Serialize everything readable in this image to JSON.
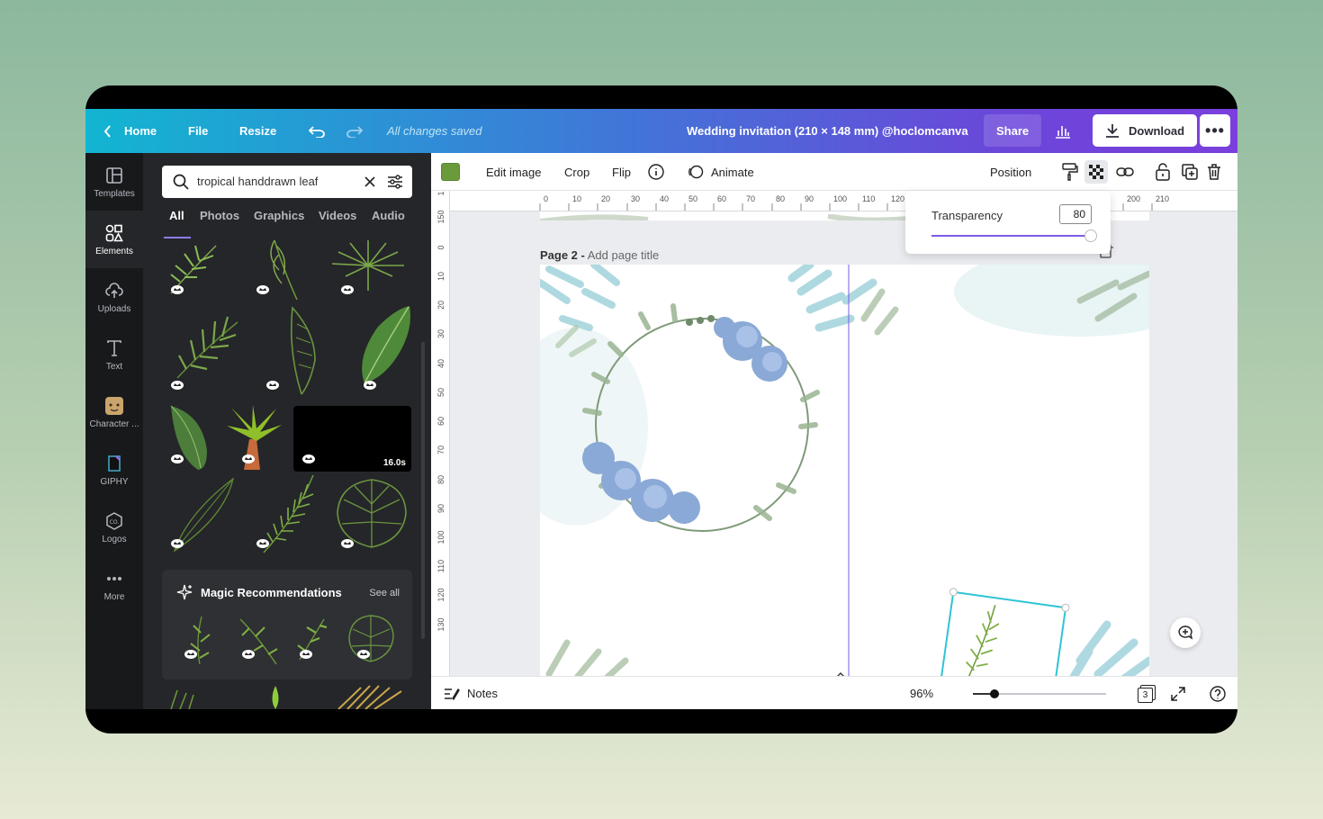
{
  "topbar": {
    "home": "Home",
    "file": "File",
    "resize": "Resize",
    "saved_status": "All changes saved",
    "doc_title": "Wedding invitation  (210 × 148 mm) @hoclomcanva",
    "share": "Share",
    "download": "Download",
    "more": "•••"
  },
  "rail": [
    {
      "label": "Templates",
      "icon": "templates-icon"
    },
    {
      "label": "Elements",
      "icon": "elements-icon"
    },
    {
      "label": "Uploads",
      "icon": "uploads-icon"
    },
    {
      "label": "Text",
      "icon": "text-icon"
    },
    {
      "label": "Character ...",
      "icon": "character-icon"
    },
    {
      "label": "GIPHY",
      "icon": "giphy-icon"
    },
    {
      "label": "Logos",
      "icon": "logos-icon"
    },
    {
      "label": "More",
      "icon": "more-icon"
    }
  ],
  "panel": {
    "search_value": "tropical handdrawn leaf",
    "tabs": [
      "All",
      "Photos",
      "Graphics",
      "Videos",
      "Audio"
    ],
    "video_duration": "16.0s",
    "magic_title": "Magic Recommendations",
    "see_all": "See all"
  },
  "toolbar": {
    "edit_image": "Edit image",
    "crop": "Crop",
    "flip": "Flip",
    "animate": "Animate",
    "position": "Position",
    "swatch_color": "#6b9a3a"
  },
  "ruler": {
    "h": [
      "0",
      "10",
      "20",
      "30",
      "40",
      "50",
      "60",
      "70",
      "80",
      "90",
      "100",
      "110",
      "120",
      "200",
      "210"
    ],
    "v": [
      "1",
      "150",
      "0",
      "10",
      "20",
      "30",
      "40",
      "50",
      "60",
      "70",
      "80",
      "90",
      "100",
      "110",
      "120",
      "130"
    ]
  },
  "page": {
    "label": "Page 2 -",
    "title_placeholder": "Add page title"
  },
  "transparency": {
    "label": "Transparency",
    "value": "80"
  },
  "bottombar": {
    "notes": "Notes",
    "zoom": "96%",
    "page_count": "3"
  }
}
